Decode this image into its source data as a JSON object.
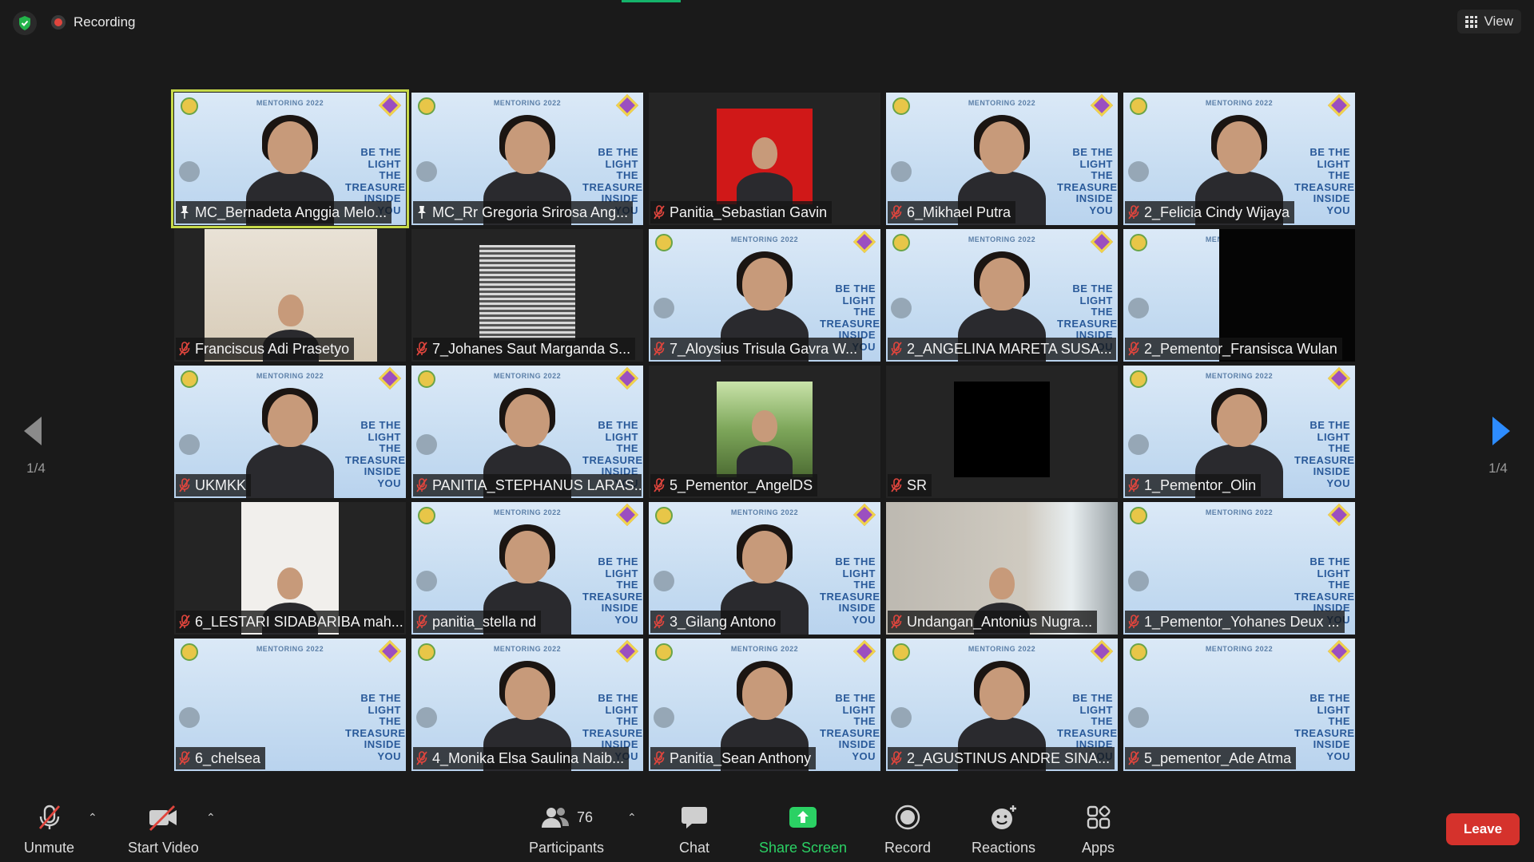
{
  "topbar": {
    "recording_label": "Recording",
    "view_label": "View"
  },
  "pager": {
    "left_indicator": "1/4",
    "right_indicator": "1/4"
  },
  "poster": {
    "title": "MENTORING 2022",
    "tagline": "BE THE LIGHT THE TREASURE INSIDE YOU"
  },
  "participants": [
    {
      "name": "MC_Bernadeta Anggia Melo...",
      "pinned": true,
      "kind": "poster-person"
    },
    {
      "name": "MC_Rr Gregoria Srirosa Ang...",
      "pinned": true,
      "kind": "poster-person"
    },
    {
      "name": "Panitia_Sebastian Gavin",
      "pinned": false,
      "kind": "red-photo"
    },
    {
      "name": "6_Mikhael Putra",
      "pinned": false,
      "kind": "poster-person"
    },
    {
      "name": "2_Felicia Cindy Wijaya",
      "pinned": false,
      "kind": "poster-person"
    },
    {
      "name": "Franciscus Adi Prasetyo",
      "pinned": false,
      "kind": "room"
    },
    {
      "name": "7_Johanes Saut Marganda S...",
      "pinned": false,
      "kind": "stripes"
    },
    {
      "name": "7_Aloysius Trisula Gavra W...",
      "pinned": false,
      "kind": "poster-person"
    },
    {
      "name": "2_ANGELINA MARETA SUSA...",
      "pinned": false,
      "kind": "poster-person"
    },
    {
      "name": "2_Pementor_Fransisca Wulan",
      "pinned": false,
      "kind": "poster-dark"
    },
    {
      "name": "UKMKK",
      "pinned": false,
      "kind": "poster-person"
    },
    {
      "name": "PANITIA_STEPHANUS LARAS...",
      "pinned": false,
      "kind": "poster-person"
    },
    {
      "name": "5_Pementor_AngelDS",
      "pinned": false,
      "kind": "forest"
    },
    {
      "name": "SR",
      "pinned": false,
      "kind": "black"
    },
    {
      "name": "1_Pementor_Olin",
      "pinned": false,
      "kind": "poster-person"
    },
    {
      "name": "6_LESTARI SIDABARIBA mah...",
      "pinned": false,
      "kind": "white"
    },
    {
      "name": "panitia_stella nd",
      "pinned": false,
      "kind": "poster-person"
    },
    {
      "name": "3_Gilang Antono",
      "pinned": false,
      "kind": "poster-person"
    },
    {
      "name": "Undangan_Antonius Nugra...",
      "pinned": false,
      "kind": "window"
    },
    {
      "name": "1_Pementor_Yohanes Deux ...",
      "pinned": false,
      "kind": "poster"
    },
    {
      "name": "6_chelsea",
      "pinned": false,
      "kind": "poster"
    },
    {
      "name": "4_Monika Elsa Saulina Naib...",
      "pinned": false,
      "kind": "poster-person"
    },
    {
      "name": "Panitia_Sean Anthony",
      "pinned": false,
      "kind": "poster-person"
    },
    {
      "name": "2_AGUSTINUS ANDRE SINA...",
      "pinned": false,
      "kind": "poster-person"
    },
    {
      "name": "5_pementor_Ade Atma",
      "pinned": false,
      "kind": "poster"
    }
  ],
  "toolbar": {
    "unmute_label": "Unmute",
    "start_video_label": "Start Video",
    "participants_label": "Participants",
    "participants_count": "76",
    "chat_label": "Chat",
    "share_screen_label": "Share Screen",
    "record_label": "Record",
    "reactions_label": "Reactions",
    "apps_label": "Apps",
    "leave_label": "Leave"
  },
  "colors": {
    "background": "#1a1a1a",
    "active_speaker": "#c6d94a",
    "share_green": "#2bd164",
    "leave_red": "#d5322c",
    "nav_arrow_active": "#2d8cff",
    "mic_off_red": "#e0453d"
  },
  "icons": {
    "security": "shield-check-icon",
    "recording": "record-dot-icon",
    "view": "grid-icon",
    "prev": "arrow-left-icon",
    "next": "arrow-right-icon",
    "mic_muted": "mic-off-icon",
    "pinned": "pin-icon"
  }
}
